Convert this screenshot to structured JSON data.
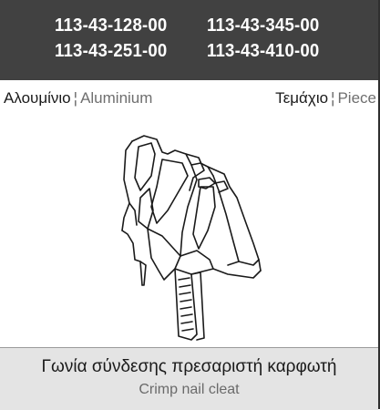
{
  "header": {
    "codes": [
      "113-43-128-00",
      "113-43-345-00",
      "113-43-251-00",
      "113-43-410-00"
    ]
  },
  "material": {
    "greek": "Αλουμίνιο",
    "separator": "¦",
    "english": "Aluminium"
  },
  "unit": {
    "greek": "Τεμάχιο",
    "separator": "¦",
    "english": "Piece"
  },
  "product": {
    "name_greek": "Γωνία σύνδεσης πρεσαριστή καρφωτή",
    "name_english": "Crimp nail cleat"
  },
  "colors": {
    "header_bg": "#414141",
    "footer_bg": "#e4e4e4",
    "border": "#2f2f2f"
  },
  "icons": {
    "drawing": "crimp-nail-cleat-drawing"
  }
}
